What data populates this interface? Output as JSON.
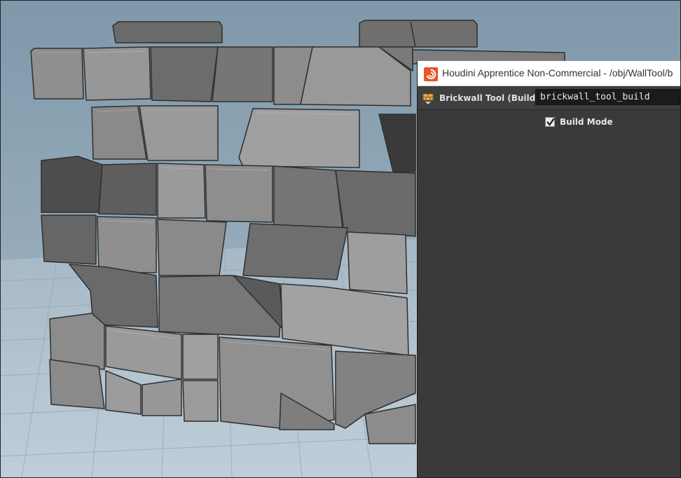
{
  "window": {
    "title": "Houdini Apprentice Non-Commercial - /obj/WallTool/b",
    "app_icon": "houdini-swirl-icon"
  },
  "parameter_editor": {
    "operator_type_label": "Brickwall Tool (Build)",
    "operator_icon": "brick-tool-icon",
    "node_name_value": "brickwall_tool_build",
    "params": [
      {
        "label": "Build Mode",
        "type": "toggle",
        "checked": true
      }
    ]
  },
  "viewport": {
    "content": "3d-brick-wall-model"
  },
  "colors": {
    "accent": "#e8552b",
    "panel_bg": "#3a3a3a",
    "viewport_bg": "#8fa6b6"
  }
}
